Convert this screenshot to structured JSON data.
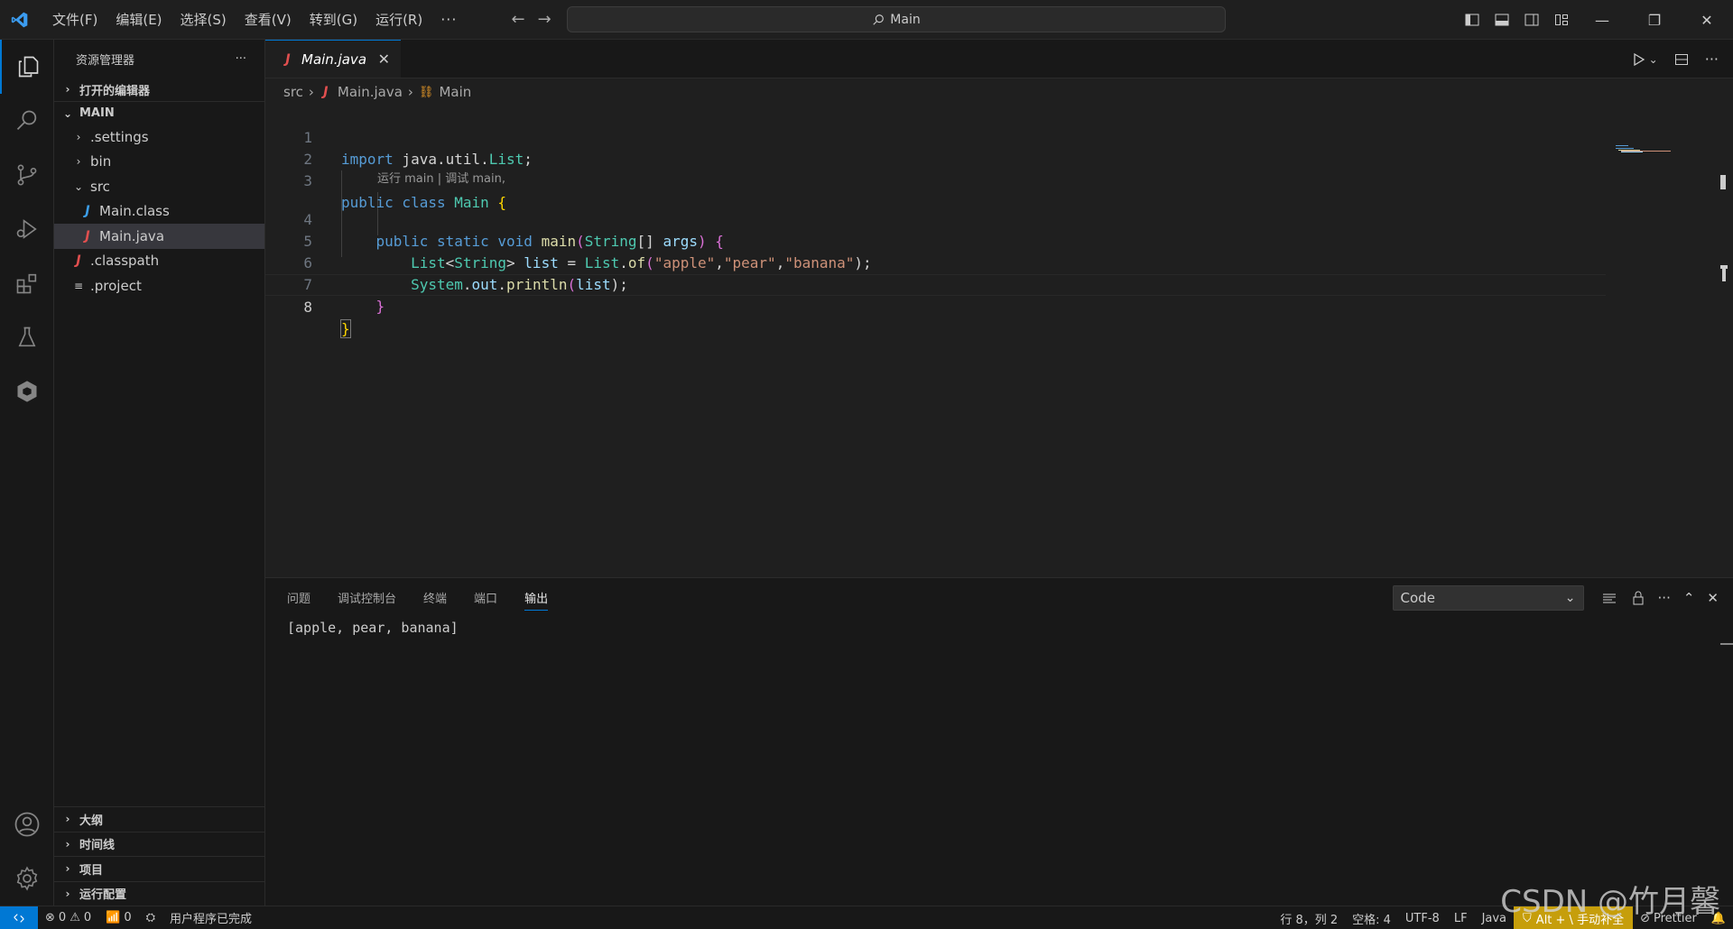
{
  "menu": [
    "文件(F)",
    "编辑(E)",
    "选择(S)",
    "查看(V)",
    "转到(G)",
    "运行(R)"
  ],
  "menu_more": "···",
  "search": {
    "text": "Main"
  },
  "window_buttons": {
    "minimize": "—",
    "restore": "❐",
    "close": "✕"
  },
  "sidebar": {
    "title": "资源管理器",
    "more": "···",
    "open_editors": "打开的编辑器",
    "workspace": "MAIN",
    "tree": [
      {
        "label": ".settings",
        "type": "folder"
      },
      {
        "label": "bin",
        "type": "folder"
      },
      {
        "label": "src",
        "type": "folder-open"
      },
      {
        "label": "Main.class",
        "type": "java"
      },
      {
        "label": "Main.java",
        "type": "java"
      },
      {
        "label": ".classpath",
        "type": "java"
      },
      {
        "label": ".project",
        "type": "text"
      }
    ],
    "bottom_sections": [
      "大纲",
      "时间线",
      "项目",
      "运行配置"
    ]
  },
  "editor": {
    "tab_label": "Main.java",
    "tab_close": "✕",
    "breadcrumb": {
      "folder": "src",
      "file": "Main.java",
      "symbol": "Main"
    },
    "codelens": "运行 main | 调试 main,",
    "line_numbers": [
      "1",
      "2",
      "3",
      "4",
      "5",
      "6",
      "7",
      "8"
    ],
    "lines": {
      "l1": {
        "kw": "import",
        "rest": " java.util.",
        "ty": "List",
        "end": ";"
      },
      "l3": {
        "kw": "public class",
        "name": "Main",
        "brace": "{"
      },
      "l4": {
        "kw": "public static void",
        "fn": "main",
        "p1": "(",
        "ty": "String",
        "p2": "[] ",
        "var": "args",
        "p3": ") ",
        "brace": "{"
      },
      "l5": {
        "ty1": "List",
        "lt": "<",
        "ty2": "String",
        "gt": "> ",
        "var": "list",
        "eq": " = ",
        "ty3": "List",
        "dot": ".",
        "fn": "of",
        "p1": "(",
        "s1": "\"apple\"",
        "c1": ",",
        "s2": "\"pear\"",
        "c2": ",",
        "s3": "\"banana\"",
        "end": ");"
      },
      "l6": {
        "ty": "System",
        "dot1": ".",
        "var1": "out",
        "dot2": ".",
        "fn": "println",
        "p1": "(",
        "var2": "list",
        "end": ");"
      },
      "l7": {
        "brace": "}"
      },
      "l8": {
        "brace": "}"
      }
    }
  },
  "panel": {
    "tabs": [
      "问题",
      "调试控制台",
      "终端",
      "端口",
      "输出"
    ],
    "active_tab": "输出",
    "select_value": "Code",
    "output": "[apple, pear, banana]"
  },
  "statusbar": {
    "errors": "0",
    "warnings": "0",
    "ports": "0",
    "message": "用户程序已完成",
    "position": "行 8，列 2",
    "spaces": "空格: 4",
    "encoding": "UTF-8",
    "eol": "LF",
    "language": "Java",
    "copilot": "Alt + \\ 手动补全",
    "prettier": "Prettier"
  },
  "watermark": "CSDN @竹月馨",
  "colors": {
    "accent": "#0078d4",
    "warning_bg": "#c69e0b",
    "java_icon": "#e14f4f"
  }
}
